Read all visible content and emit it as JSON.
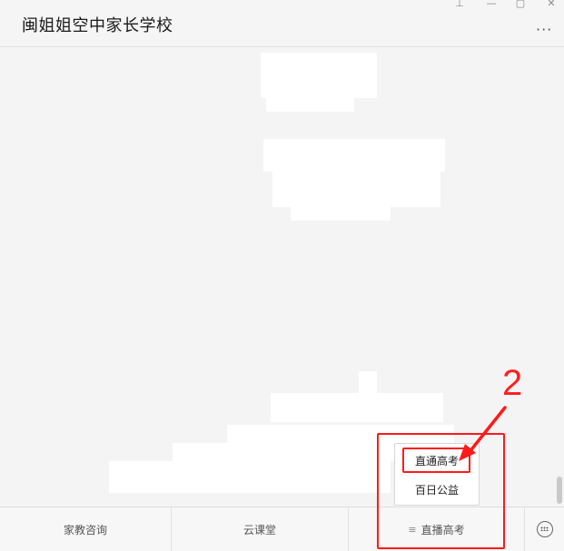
{
  "window": {
    "title": "闽姐姐空中家长学校",
    "controls": {
      "pin": "⊥",
      "minimize": "—",
      "maximize": "▢",
      "close": "✕"
    },
    "more": "···"
  },
  "bottom_menu": {
    "items": [
      {
        "label": "家教咨询"
      },
      {
        "label": "云课堂"
      },
      {
        "label": "直播高考",
        "menu_glyph": "≡"
      }
    ],
    "keyboard_icon": "keyboard-icon"
  },
  "submenu": {
    "items": [
      {
        "label": "直通高考"
      },
      {
        "label": "百日公益"
      }
    ]
  },
  "annotation": {
    "step_number": "2",
    "color": "#ff1a1a"
  }
}
